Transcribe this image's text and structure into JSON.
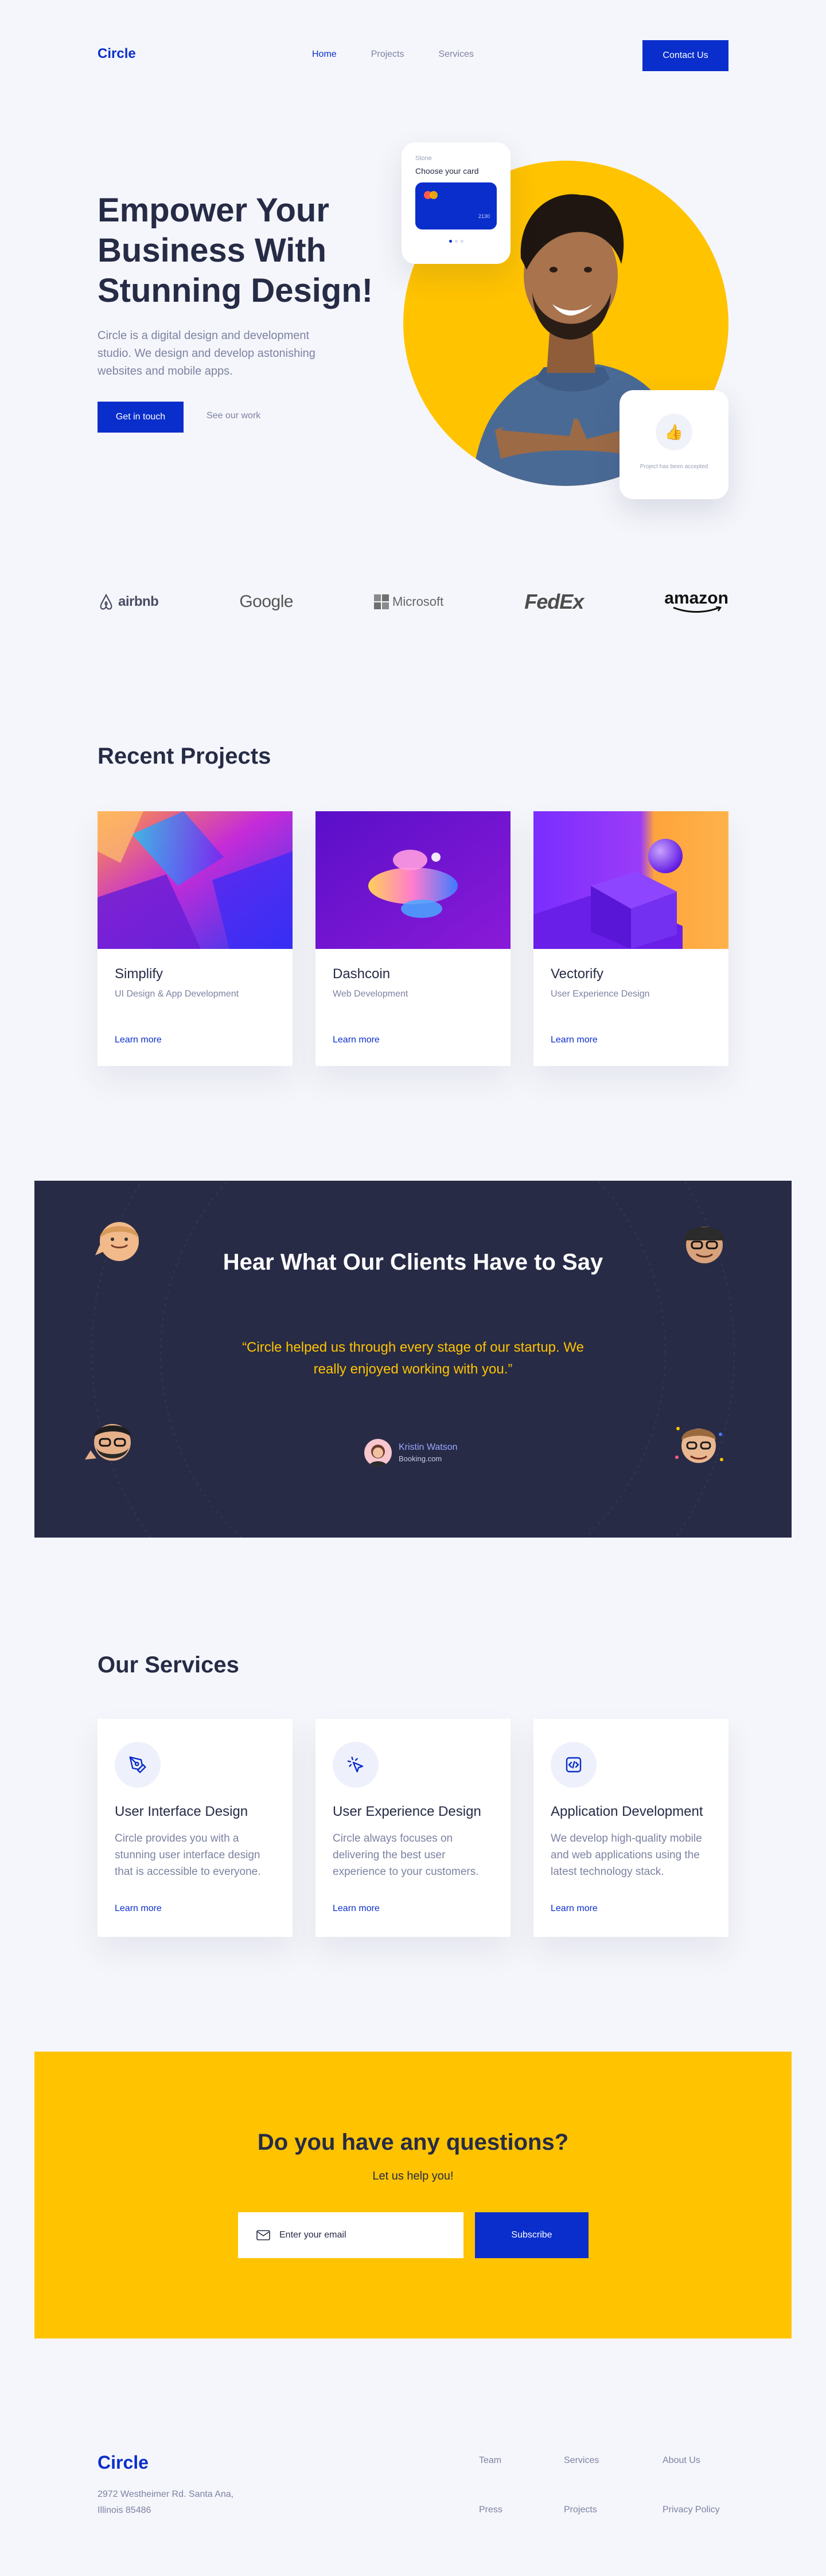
{
  "nav": {
    "logo": "Circle",
    "links": [
      "Home",
      "Projects",
      "Services"
    ],
    "contact": "Contact Us"
  },
  "hero": {
    "title_lines": [
      "Empower Your",
      "Business With",
      "Stunning Design!"
    ],
    "description": "Circle is a digital design and development studio. We design and develop astonishing websites and mobile apps.",
    "primary_button": "Get in touch",
    "secondary_button": "See our work",
    "card": {
      "label": "Stone",
      "title": "Choose your card",
      "number": "2130"
    },
    "accept_text": "Project has been accepted"
  },
  "logos": [
    "airbnb",
    "Google",
    "Microsoft",
    "FedEx",
    "amazon"
  ],
  "projects": {
    "title": "Recent Projects",
    "items": [
      {
        "title": "Simplify",
        "subtitle": "UI Design & App Development",
        "link": "Learn more"
      },
      {
        "title": "Dashcoin",
        "subtitle": "Web Development",
        "link": "Learn more"
      },
      {
        "title": "Vectorify",
        "subtitle": "User Experience Design",
        "link": "Learn more"
      }
    ]
  },
  "testimonial": {
    "title": "Hear What Our Clients Have to Say",
    "quote": "“Circle helped us through every stage of our startup. We really enjoyed working with you.”",
    "author": "Kristin Watson",
    "company": "Booking.com"
  },
  "services": {
    "title": "Our Services",
    "items": [
      {
        "icon": "pen-tool-icon",
        "title": "User Interface Design",
        "desc": "Circle provides you with a stunning user interface design that is accessible to everyone.",
        "link": "Learn more"
      },
      {
        "icon": "cursor-click-icon",
        "title": "User Experience Design",
        "desc": "Circle always focuses on delivering the best user experience to your customers.",
        "link": "Learn more"
      },
      {
        "icon": "code-icon",
        "title": "Application Development",
        "desc": "We develop high-quality mobile and web applications using the latest technology stack.",
        "link": "Learn more"
      }
    ]
  },
  "newsletter": {
    "title": "Do you have any questions?",
    "subtitle": "Let us help you!",
    "placeholder": "Enter your email",
    "button": "Subscribe"
  },
  "footer": {
    "logo": "Circle",
    "address": "2972 Westheimer Rd. Santa Ana, Illinois 85486",
    "links": [
      "Team",
      "Services",
      "About Us",
      "Press",
      "Projects",
      "Privacy Policy"
    ]
  },
  "colors": {
    "brand": "#0a2ecb",
    "accent": "#ffc300",
    "dark": "#272b46"
  }
}
